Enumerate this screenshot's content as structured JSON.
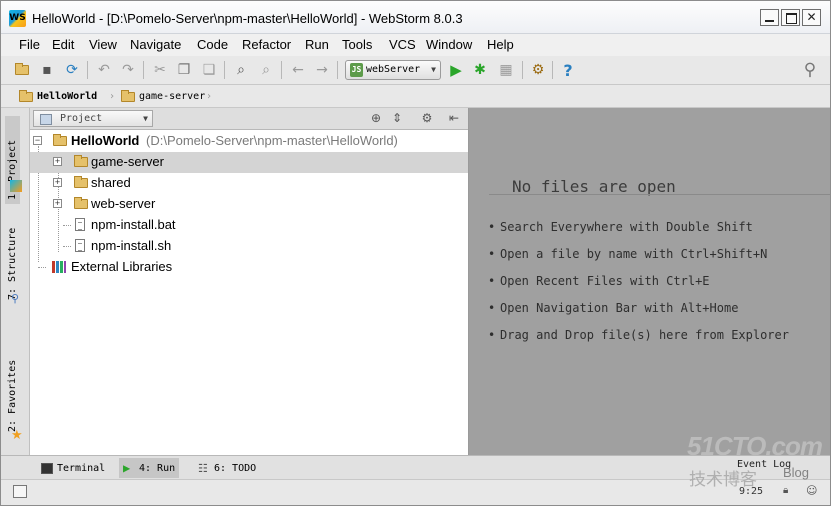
{
  "window": {
    "title": "HelloWorld - [D:\\Pomelo-Server\\npm-master\\HelloWorld] - WebStorm 8.0.3",
    "app_logo_text": "WS"
  },
  "menu": [
    "File",
    "Edit",
    "View",
    "Navigate",
    "Code",
    "Refactor",
    "Run",
    "Tools",
    "VCS",
    "Window",
    "Help"
  ],
  "toolbar": {
    "run_config": "webServer",
    "run_config_badge": "JS"
  },
  "breadcrumb": [
    "HelloWorld",
    "game-server"
  ],
  "side_tabs": {
    "project": "1: Project",
    "structure": "7: Structure",
    "favorites": "2: Favorites"
  },
  "project_panel": {
    "view_mode": "Project",
    "tree": {
      "root_name": "HelloWorld",
      "root_path": "(D:\\Pomelo-Server\\npm-master\\HelloWorld)",
      "items": [
        {
          "label": "game-server",
          "type": "folder",
          "selected": true
        },
        {
          "label": "shared",
          "type": "folder"
        },
        {
          "label": "web-server",
          "type": "folder"
        },
        {
          "label": "npm-install.bat",
          "type": "file"
        },
        {
          "label": "npm-install.sh",
          "type": "file"
        }
      ],
      "external_libraries": "External Libraries"
    }
  },
  "editor": {
    "empty_title": "No files are open",
    "hints": [
      "Search Everywhere with Double Shift",
      "Open a file by name with Ctrl+Shift+N",
      "Open Recent Files with Ctrl+E",
      "Open Navigation Bar with Alt+Home",
      "Drag and Drop file(s) here from Explorer"
    ]
  },
  "bottom_tabs": {
    "terminal": "Terminal",
    "run": "4: Run",
    "todo": "6: TODO",
    "event_log": "Event Log"
  },
  "status": {
    "position": "9:25"
  },
  "watermark": {
    "site": "51CTO.com",
    "subtitle": "技术博客",
    "blog": "Blog"
  }
}
